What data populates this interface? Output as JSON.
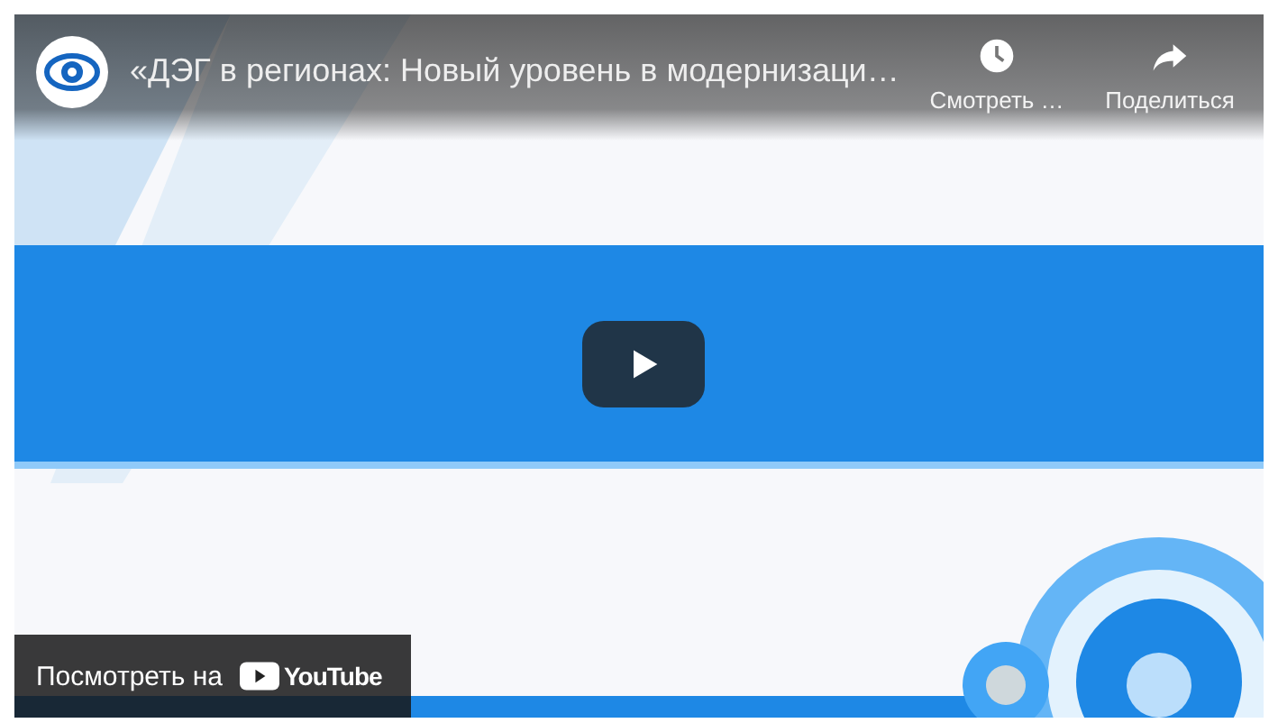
{
  "player": {
    "title": "«ДЭГ в регионах: Новый уровень в модернизаци…",
    "actions": [
      {
        "kind": "watch_later",
        "label": "Смотреть …"
      },
      {
        "kind": "share",
        "label": "Поделиться"
      }
    ],
    "watch_on": {
      "label": "Посмотреть на",
      "brand": "YouTube"
    }
  }
}
